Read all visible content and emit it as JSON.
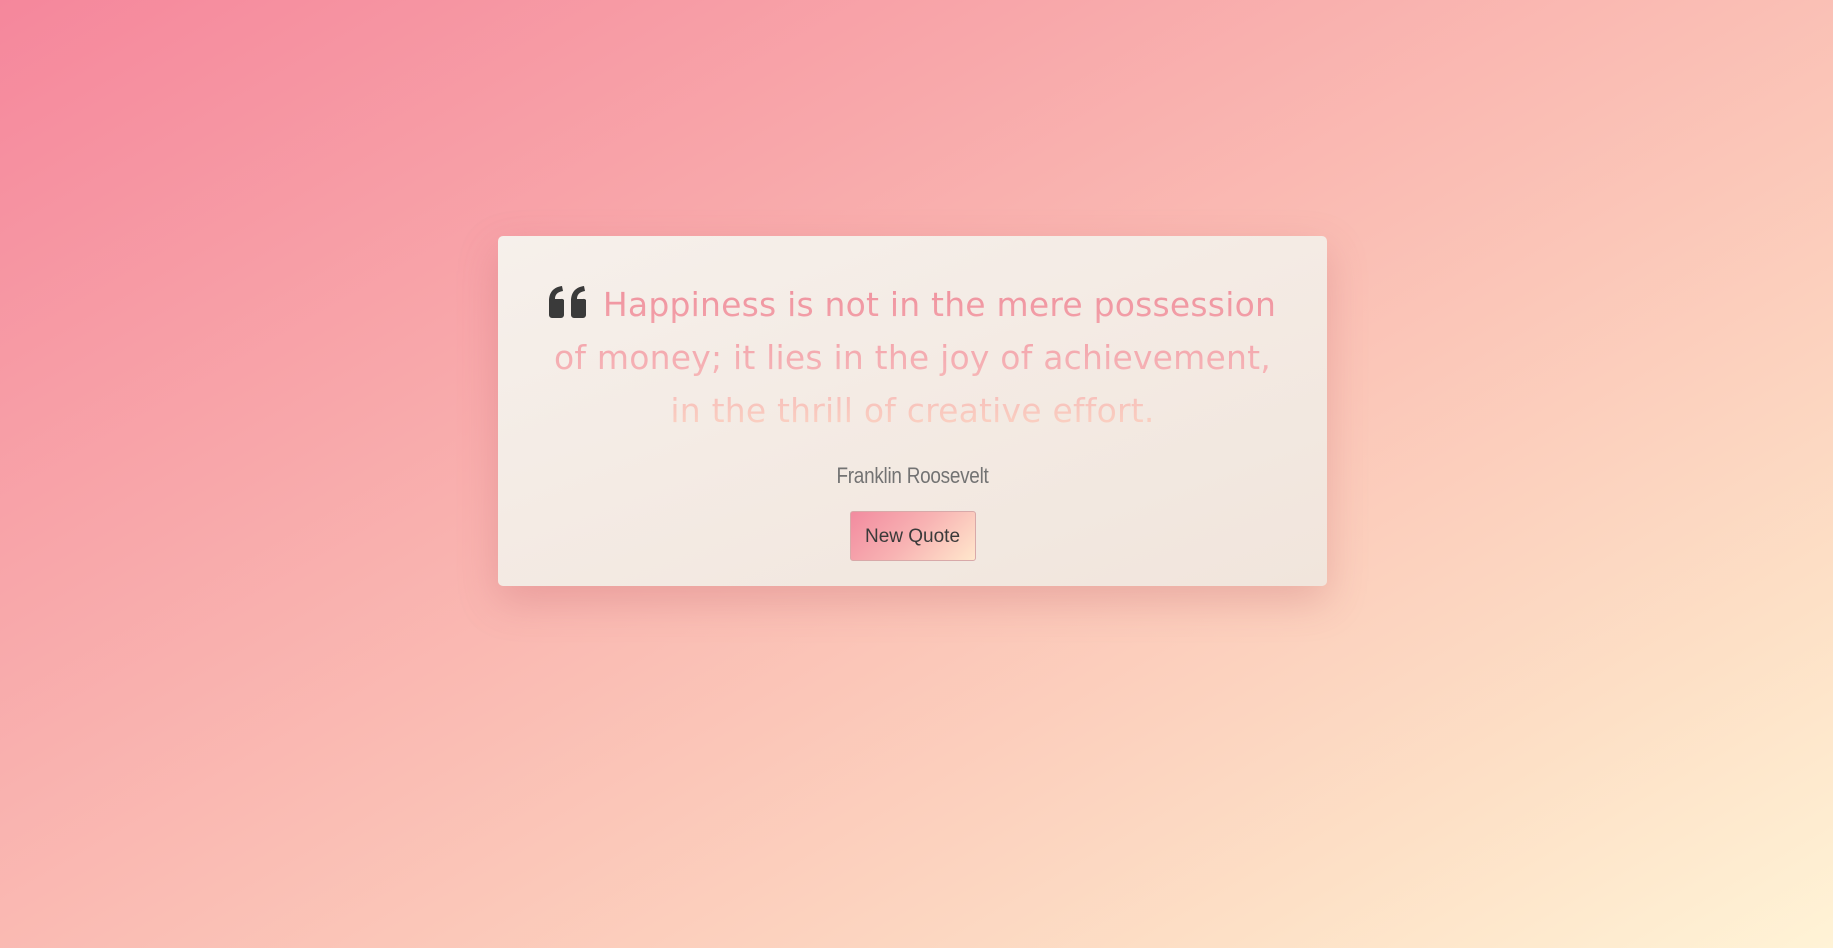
{
  "quote": {
    "icon": "quote-left-icon",
    "text": "Happiness is not in the mere possession of money; it lies in the joy of achievement, in the thrill of creative effort.",
    "author": "Franklin Roosevelt"
  },
  "actions": {
    "new_quote_label": "New Quote"
  },
  "colors": {
    "background_start": "#f5879c",
    "background_end": "#fff3d6",
    "card": "#f4ece6",
    "icon": "#3a3a3a"
  }
}
